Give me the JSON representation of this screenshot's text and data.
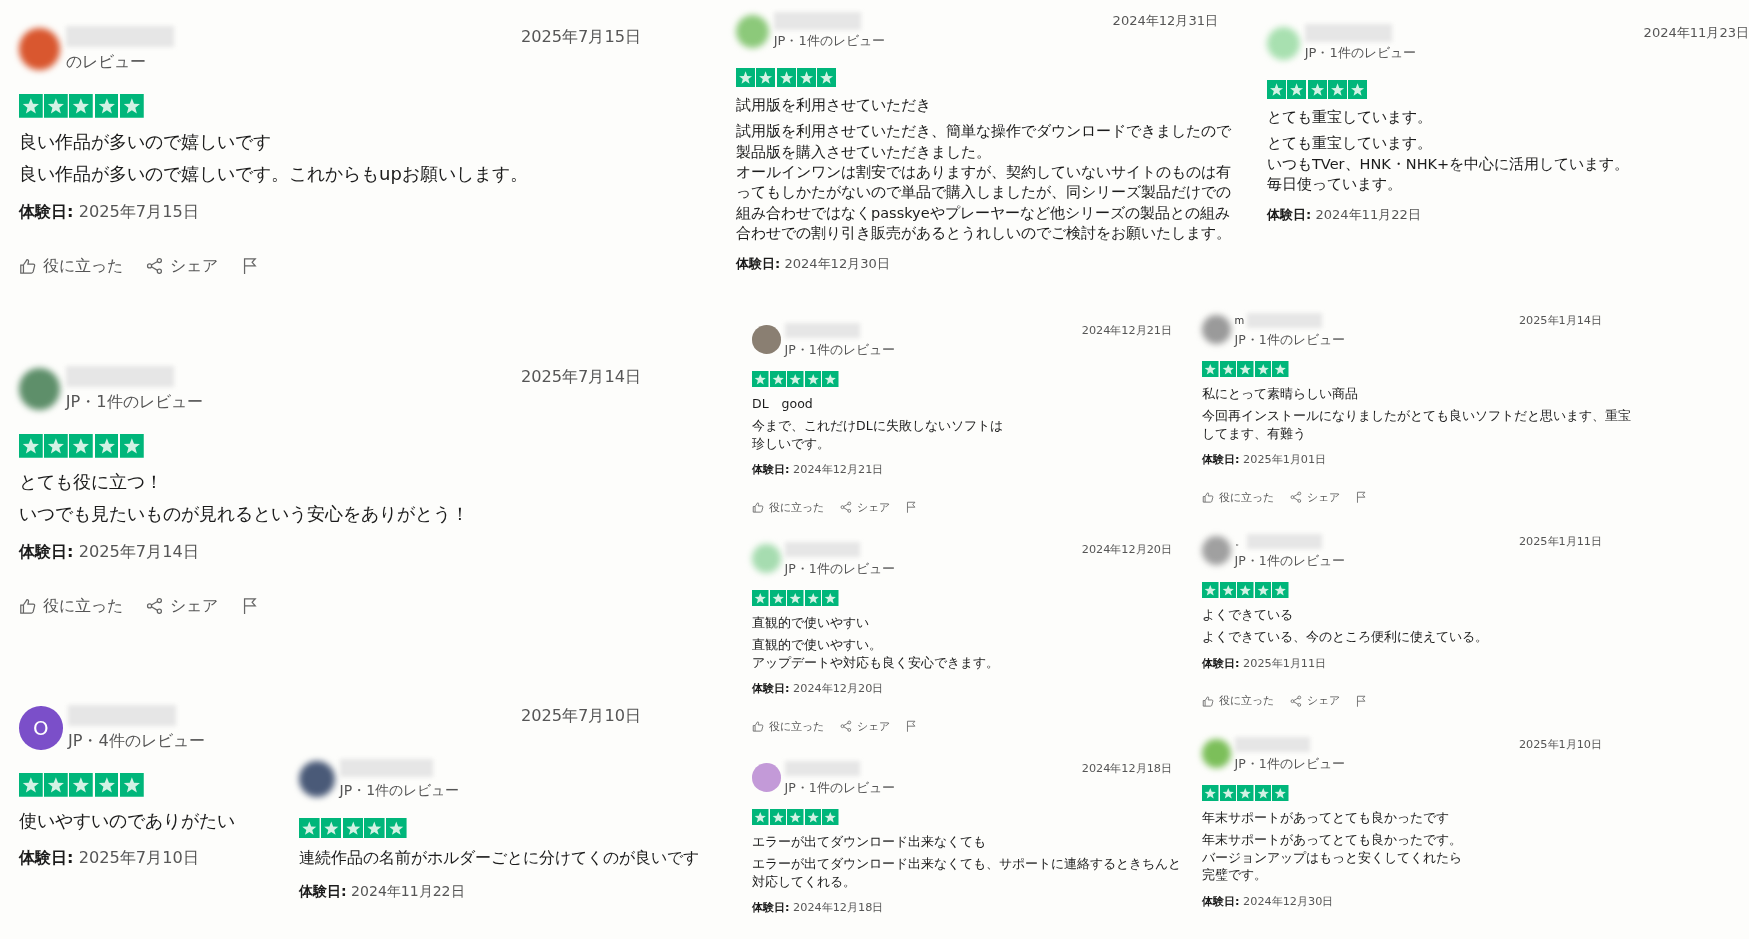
{
  "reviews": [
    {
      "avatar": {
        "kind": "blurred",
        "color": "#d9572f"
      },
      "reviewer": "のレビュー",
      "date": "2025年7月15日",
      "stars": 5,
      "title": "良い作品が多いので嬉しいです",
      "body": [
        "良い作品が多いので嬉しいです。これからもupお願いします。"
      ],
      "experience": {
        "label": "体験日:",
        "date": "2025年7月15日"
      },
      "actions": {
        "helpful": "役に立った",
        "share": "シェア"
      }
    },
    {
      "avatar": {
        "kind": "blurred",
        "color": "#5e8f6a"
      },
      "reviewer": "JP・1件のレビュー",
      "date": "2025年7月14日",
      "stars": 5,
      "title": "とても役に立つ！",
      "body": [
        "いつでも見たいものが見れるという安心をありがとう！"
      ],
      "experience": {
        "label": "体験日:",
        "date": "2025年7月14日"
      },
      "actions": {
        "helpful": "役に立った",
        "share": "シェア"
      }
    },
    {
      "avatar": {
        "kind": "initial",
        "color": "#7b4fc9",
        "initial": "O"
      },
      "reviewer": "JP・4件のレビュー",
      "date": "2025年7月10日",
      "stars": 5,
      "title": "使いやすいのでありがたい",
      "experience": {
        "label": "体験日:",
        "date": "2025年7月10日"
      }
    },
    {
      "avatar": {
        "kind": "blurred",
        "color": "#4a5a78"
      },
      "reviewer": "JP・1件のレビュー",
      "stars": 5,
      "title": "連続作品の名前がホルダーごとに分けてくのが良いです",
      "experience": {
        "label": "体験日:",
        "date": "2024年11月22日"
      }
    },
    {
      "avatar": {
        "kind": "blurred",
        "color": "#8cc97a"
      },
      "reviewer": "JP・1件のレビュー",
      "date": "2024年12月31日",
      "stars": 5,
      "title": "試用版を利用させていただき",
      "body": [
        "試用版を利用させていただき、簡単な操作でダウンロードできましたので",
        "製品版を購入させていただきました。",
        "オールインワンは割安ではありますが、契約していないサイトのものは有",
        "ってもしかたがないので単品で購入しましたが、同シリーズ製品だけでの",
        "組み合わせではなくpasskyeやプレーヤーなど他シリーズの製品との組み",
        "合わせでの割り引き販売があるとうれしいのでご検討をお願いたします。"
      ],
      "experience": {
        "label": "体験日:",
        "date": "2024年12月30日"
      }
    },
    {
      "avatar": {
        "kind": "blurred",
        "color": "#a8e0b0"
      },
      "reviewer": "JP・1件のレビュー",
      "date": "2024年11月23日",
      "stars": 5,
      "title": "とても重宝しています。",
      "body": [
        "とても重宝しています。",
        "いつもTVer、HNK・NHK+を中心に活用しています。",
        "毎日使っています。"
      ],
      "experience": {
        "label": "体験日:",
        "date": "2024年11月22日"
      }
    },
    {
      "avatar": {
        "kind": "image",
        "color": "#8a7f72"
      },
      "reviewer": "JP・1件のレビュー",
      "date": "2024年12月21日",
      "stars": 5,
      "title": "DL　good",
      "body": [
        "今まで、これだけDLに失敗しないソフトは",
        "珍しいです。"
      ],
      "experience": {
        "label": "体験日:",
        "date": "2024年12月21日"
      },
      "actions": {
        "helpful": "役に立った",
        "share": "シェア"
      }
    },
    {
      "avatar": {
        "kind": "blurred",
        "color": "#a6dcb0"
      },
      "reviewer": "JP・1件のレビュー",
      "date": "2024年12月20日",
      "stars": 5,
      "title": "直観的で使いやすい",
      "body": [
        "直観的で使いやすい。",
        "アップデートや対応も良く安心できます。"
      ],
      "experience": {
        "label": "体験日:",
        "date": "2024年12月20日"
      },
      "actions": {
        "helpful": "役に立った",
        "share": "シェア"
      }
    },
    {
      "avatar": {
        "kind": "image",
        "color": "#c39ad8"
      },
      "reviewer": "JP・1件のレビュー",
      "date": "2024年12月18日",
      "stars": 5,
      "title": "エラーが出てダウンロード出来なくても",
      "body": [
        "エラーが出てダウンロード出来なくても、サポートに連絡するときちんと",
        "対応してくれる。"
      ],
      "experience": {
        "label": "体験日:",
        "date": "2024年12月18日"
      }
    },
    {
      "avatar": {
        "kind": "blurred",
        "color": "#9a9a9a"
      },
      "name": "m",
      "reviewer": "JP・1件のレビュー",
      "date": "2025年1月14日",
      "stars": 5,
      "title": "私にとって素晴らしい商品",
      "body": [
        "今回再インストールになりましたがとても良いソフトだと思います、重宝",
        "してます、有難う"
      ],
      "experience": {
        "label": "体験日:",
        "date": "2025年1月01日"
      },
      "actions": {
        "helpful": "役に立った",
        "share": "シェア"
      }
    },
    {
      "avatar": {
        "kind": "blurred",
        "color": "#a0a0a0"
      },
      "name": "。",
      "reviewer": "JP・1件のレビュー",
      "date": "2025年1月11日",
      "stars": 5,
      "title": "よくできている",
      "body": [
        "よくできている、今のところ便利に使えている。"
      ],
      "experience": {
        "label": "体験日:",
        "date": "2025年1月11日"
      },
      "actions": {
        "helpful": "役に立った",
        "share": "シェア"
      }
    },
    {
      "avatar": {
        "kind": "blurred",
        "color": "#7cbf5a"
      },
      "reviewer": "JP・1件のレビュー",
      "date": "2025年1月10日",
      "stars": 5,
      "title": "年末サポートがあってとても良かったです",
      "body": [
        "年末サポートがあってとても良かったです。",
        "バージョンアップはもっと安くしてくれたら",
        "完璧です。"
      ],
      "experience": {
        "label": "体験日:",
        "date": "2024年12月30日"
      }
    }
  ]
}
